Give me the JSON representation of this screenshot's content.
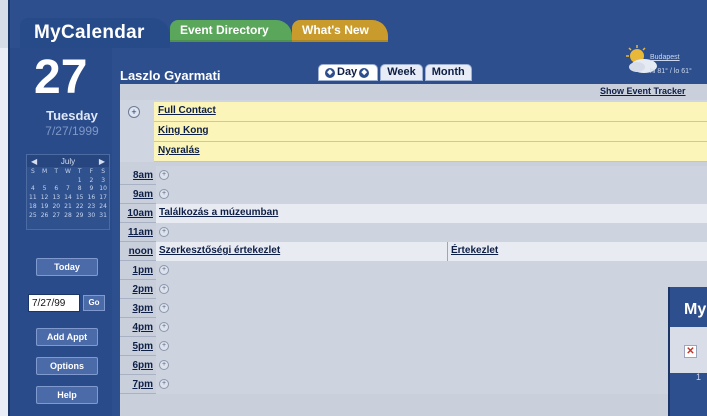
{
  "header": {
    "brand": "MyCalendar",
    "tabs": [
      {
        "label": "Event Directory"
      },
      {
        "label": "What's New"
      }
    ]
  },
  "left": {
    "day_number": "27",
    "day_name": "Tuesday",
    "date": "7/27/1999",
    "minical": {
      "month": "July",
      "weekdays": [
        "S",
        "M",
        "T",
        "W",
        "T",
        "F",
        "S"
      ],
      "weeks": [
        [
          "",
          "",
          "",
          "",
          "1",
          "2",
          "3"
        ],
        [
          "4",
          "5",
          "6",
          "7",
          "8",
          "9",
          "10"
        ],
        [
          "11",
          "12",
          "13",
          "14",
          "15",
          "16",
          "17"
        ],
        [
          "18",
          "19",
          "20",
          "21",
          "22",
          "23",
          "24"
        ],
        [
          "25",
          "26",
          "27",
          "28",
          "29",
          "30",
          "31"
        ]
      ]
    },
    "today_label": "Today",
    "date_input_value": "7/27/99",
    "go_label": "Go",
    "add_appt_label": "Add Appt",
    "options_label": "Options",
    "help_label": "Help"
  },
  "main": {
    "user_name": "Laszlo Gyarmati",
    "views": [
      {
        "label": "Day"
      },
      {
        "label": "Week"
      },
      {
        "label": "Month"
      }
    ],
    "weather": {
      "city": "Budapest",
      "temps": "hi 81° / lo 61°",
      "icon": "partly-cloudy-icon"
    },
    "show_event_tracker": "Show Event Tracker",
    "all_day_events": [
      "Full Contact",
      "King Kong",
      "Nyaralás"
    ],
    "time_slots": [
      {
        "time": "8am",
        "events": []
      },
      {
        "time": "9am",
        "events": []
      },
      {
        "time": "10am",
        "events": [
          "Találkozás a múzeumban"
        ]
      },
      {
        "time": "11am",
        "events": []
      },
      {
        "time": "noon",
        "events": [
          "Szerkesztőségi értekezlet",
          "Értekezlet"
        ]
      },
      {
        "time": "1pm",
        "events": []
      },
      {
        "time": "2pm",
        "events": []
      },
      {
        "time": "3pm",
        "events": []
      },
      {
        "time": "4pm",
        "events": []
      },
      {
        "time": "5pm",
        "events": []
      },
      {
        "time": "6pm",
        "events": []
      },
      {
        "time": "7pm",
        "events": []
      }
    ]
  },
  "popup": {
    "title": "My",
    "number": "1"
  }
}
